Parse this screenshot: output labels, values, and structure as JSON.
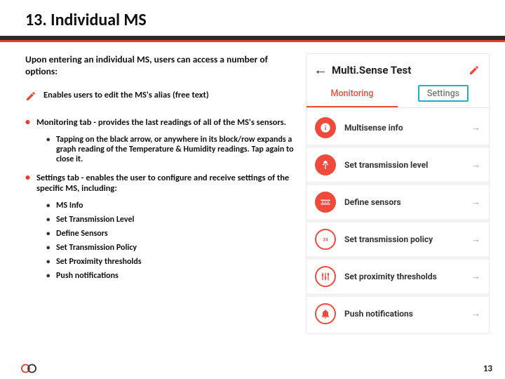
{
  "title": "13. Individual MS",
  "intro": "Upon entering an individual MS, users can access a number of options:",
  "pencilRow": "Enables users to edit the MS's alias (free text)",
  "bullets": {
    "monitoring": "Monitoring tab - provides the last readings of all of the MS's sensors.",
    "monitoring_sub": "Tapping on the black arrow, or anywhere in its block/row expands a graph reading of the Temperature & Humidity readings. Tap again to close it.",
    "settings": "Settings tab - enables the user to configure and receive settings of the specific MS, including:",
    "settings_items": {
      "a": "MS Info",
      "b": "Set Transmission Level",
      "c": "Define Sensors",
      "d": "Set Transmission Policy",
      "e": "Set Proximity thresholds",
      "f": "Push notifications"
    }
  },
  "phone": {
    "title": "Multi.Sense Test",
    "tabs": {
      "monitoring": "Monitoring",
      "settings": "Settings"
    },
    "items": {
      "info": "Multisense info",
      "level": "Set transmission level",
      "sensors": "Define sensors",
      "policy": "Set transmission policy",
      "prox": "Set proximity thresholds",
      "push": "Push notifications"
    }
  },
  "page": "13"
}
